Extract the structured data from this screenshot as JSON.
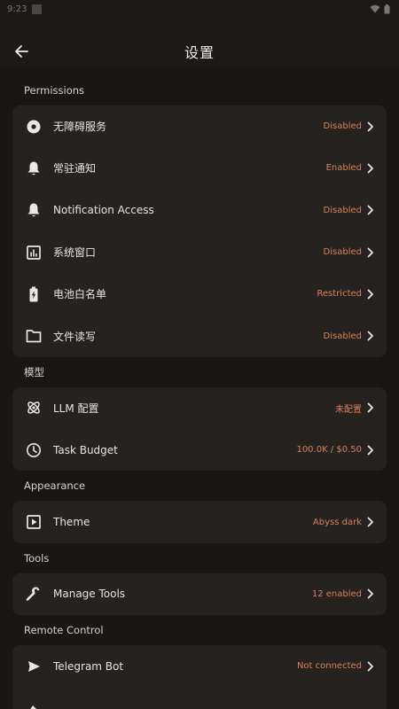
{
  "statusbar": {
    "time": "9:23"
  },
  "header": {
    "title": "设置"
  },
  "sections": [
    {
      "title": "Permissions",
      "items": [
        {
          "label": "无障碍服务",
          "value": "Disabled",
          "icon": "accessibility-icon"
        },
        {
          "label": "常驻通知",
          "value": "Enabled",
          "icon": "bell-icon"
        },
        {
          "label": "Notification Access",
          "value": "Disabled",
          "icon": "bell-icon"
        },
        {
          "label": "系统窗口",
          "value": "Disabled",
          "icon": "chart-window-icon"
        },
        {
          "label": "电池白名单",
          "value": "Restricted",
          "icon": "battery-icon"
        },
        {
          "label": "文件读写",
          "value": "Disabled",
          "icon": "folder-icon"
        }
      ]
    },
    {
      "title": "模型",
      "items": [
        {
          "label": "LLM 配置",
          "value": "未配置",
          "icon": "atom-icon"
        },
        {
          "label": "Task Budget",
          "value": "100.0K / $0.50",
          "icon": "clock-icon"
        }
      ]
    },
    {
      "title": "Appearance",
      "items": [
        {
          "label": "Theme",
          "value": "Abyss dark",
          "icon": "theme-icon"
        }
      ]
    },
    {
      "title": "Tools",
      "items": [
        {
          "label": "Manage Tools",
          "value": "12 enabled",
          "icon": "wrench-icon"
        }
      ]
    },
    {
      "title": "Remote Control",
      "items": [
        {
          "label": "Telegram Bot",
          "value": "Not connected",
          "icon": "send-icon"
        },
        {
          "label": "",
          "value": "",
          "icon": "partial-icon"
        }
      ]
    }
  ],
  "colors": {
    "accent": "#d9825c",
    "background": "#191715",
    "card": "#252220"
  }
}
